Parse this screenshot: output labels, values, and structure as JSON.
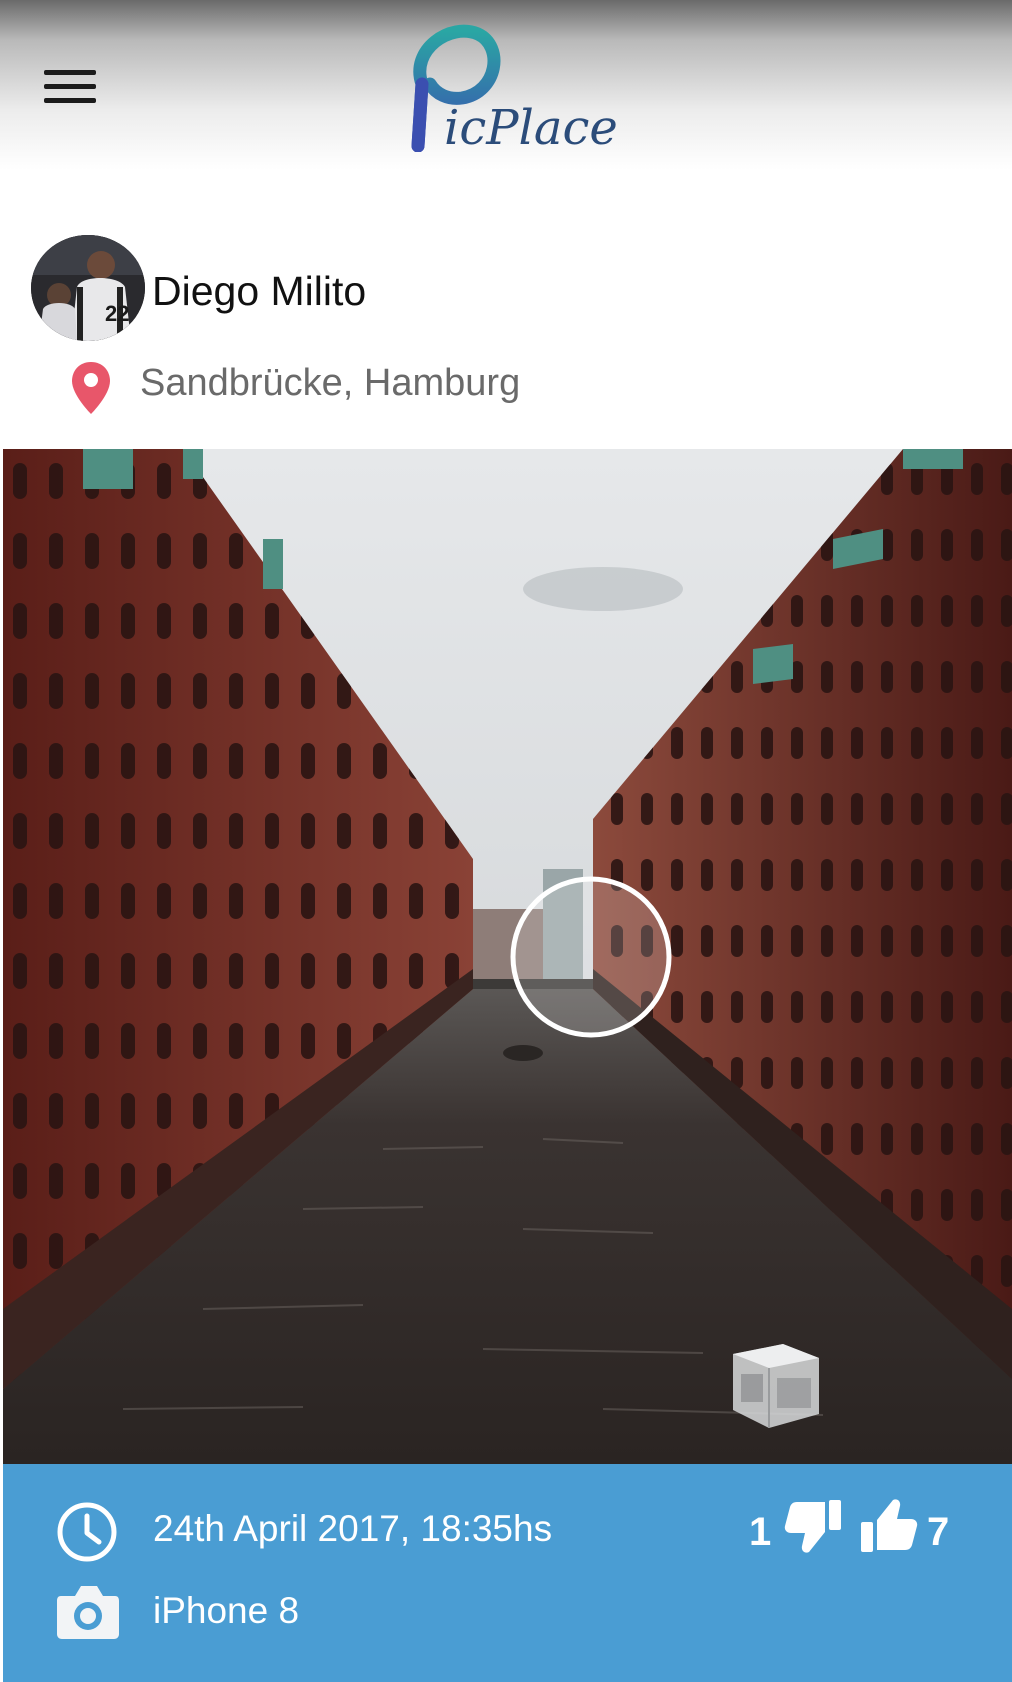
{
  "header": {
    "logo_text": "icPlace",
    "menu_icon": "hamburger-menu-icon",
    "logo_colors": [
      "#2aa0a8",
      "#3a56a8"
    ]
  },
  "post": {
    "user_name": "Diego Milito",
    "avatar_number": "22",
    "location": "Sandbrücke, Hamburg",
    "location_icon": "map-pin-icon",
    "location_icon_color": "#e8566a"
  },
  "photo": {
    "subject": "photo-canal-warehouses",
    "overlay_icons": [
      "ar-circle-marker",
      "3d-cube-icon"
    ]
  },
  "info": {
    "date": "24th April 2017, 18:35hs",
    "device": "iPhone 8",
    "dislikes": "1",
    "likes": "7",
    "background_color": "#4a9dd3",
    "icons": [
      "clock-icon",
      "camera-icon",
      "thumb-down-icon",
      "thumb-up-icon"
    ]
  }
}
